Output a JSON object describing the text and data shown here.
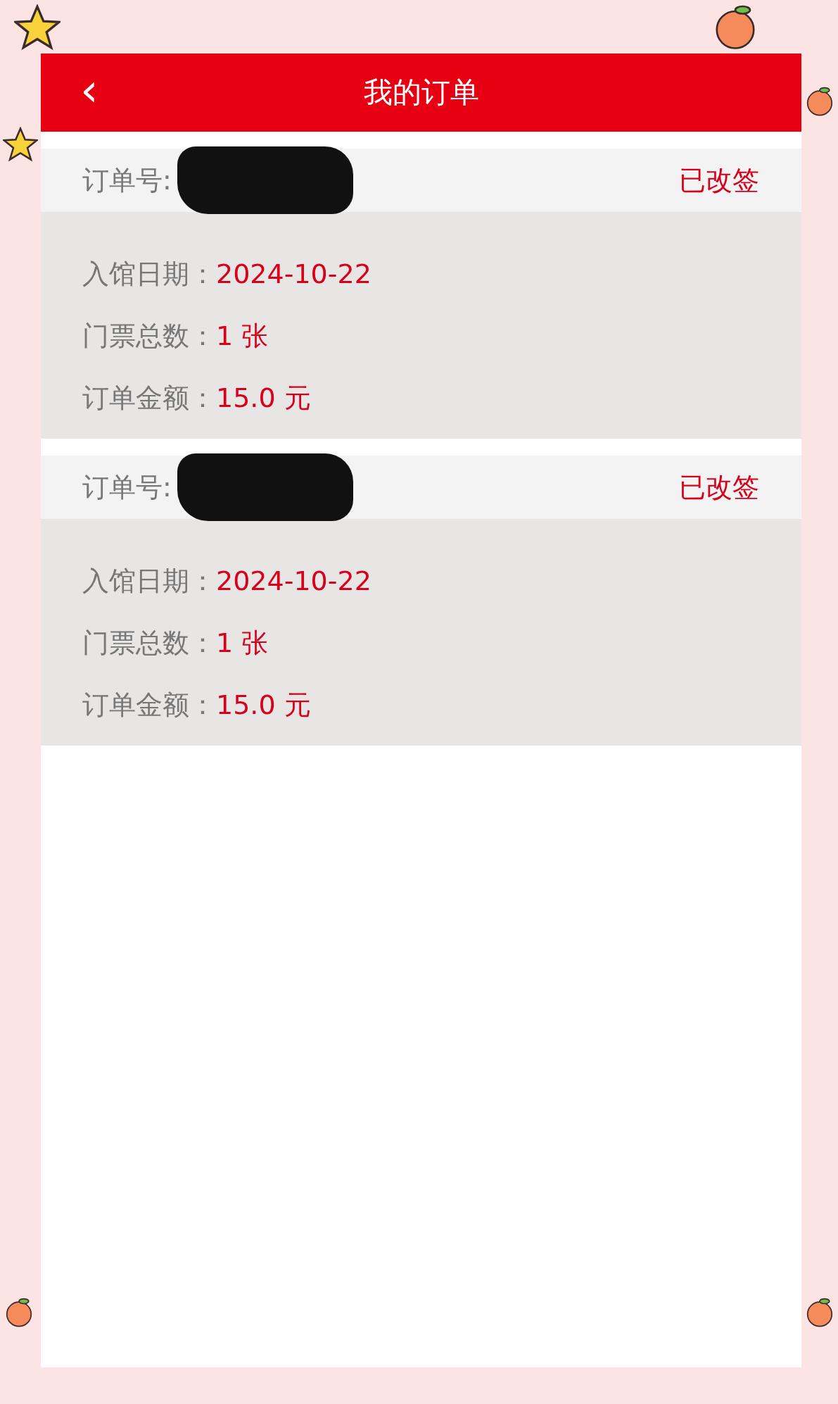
{
  "header": {
    "back_icon": "‹",
    "title": "我的订单"
  },
  "orders": [
    {
      "number_label": "订单号:",
      "number_redacted": true,
      "status": "已改签",
      "fields": [
        {
          "label": "入馆日期：",
          "value": "2024-10-22"
        },
        {
          "label": "门票总数：",
          "value": "1 张"
        },
        {
          "label": "订单金额：",
          "value": "15.0 元"
        }
      ]
    },
    {
      "number_label": "订单号:",
      "number_redacted": true,
      "status": "已改签",
      "fields": [
        {
          "label": "入馆日期：",
          "value": "2024-10-22"
        },
        {
          "label": "门票总数：",
          "value": "1 张"
        },
        {
          "label": "订单金额：",
          "value": "15.0 元"
        }
      ]
    }
  ]
}
